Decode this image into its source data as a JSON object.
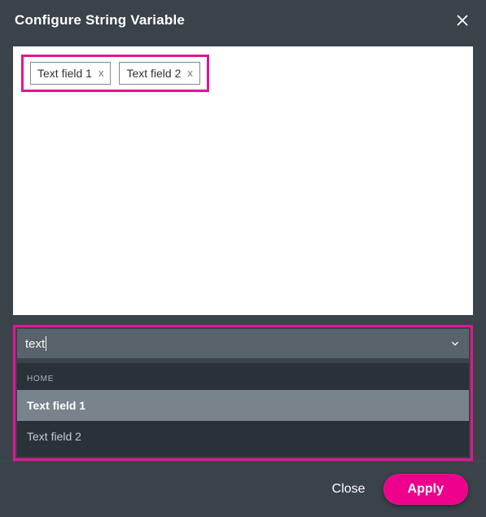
{
  "dialog": {
    "title": "Configure String Variable"
  },
  "editor": {
    "chips": [
      {
        "label": "Text field 1"
      },
      {
        "label": "Text field 2"
      }
    ]
  },
  "search": {
    "value": "text",
    "group_label": "HOME",
    "options": [
      {
        "label": "Text field 1",
        "active": true
      },
      {
        "label": "Text field 2",
        "active": false
      }
    ]
  },
  "footer": {
    "close_label": "Close",
    "apply_label": "Apply"
  },
  "colors": {
    "highlight": "#e21596",
    "apply": "#ec008c",
    "panel": "#3a424a"
  }
}
